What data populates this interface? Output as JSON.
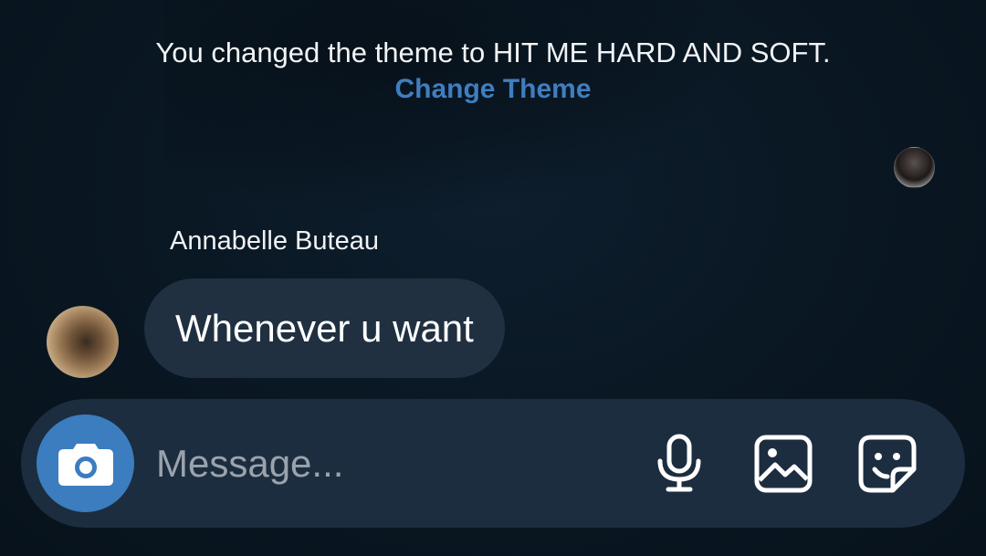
{
  "thread": {
    "system_message": "You changed the theme to HIT ME HARD AND SOFT.",
    "change_theme_label": "Change Theme",
    "sender_name": "Annabelle Buteau",
    "messages": [
      {
        "text": "Whenever u want"
      }
    ]
  },
  "composer": {
    "placeholder": "Message...",
    "icons": [
      "camera-icon",
      "microphone-icon",
      "gallery-icon",
      "sticker-icon"
    ]
  },
  "colors": {
    "background": "#0a1824",
    "link_blue": "#3f7ec0",
    "bubble": "#203041",
    "composer": "#1c2d3f",
    "camera_button": "#3b7dbf"
  }
}
